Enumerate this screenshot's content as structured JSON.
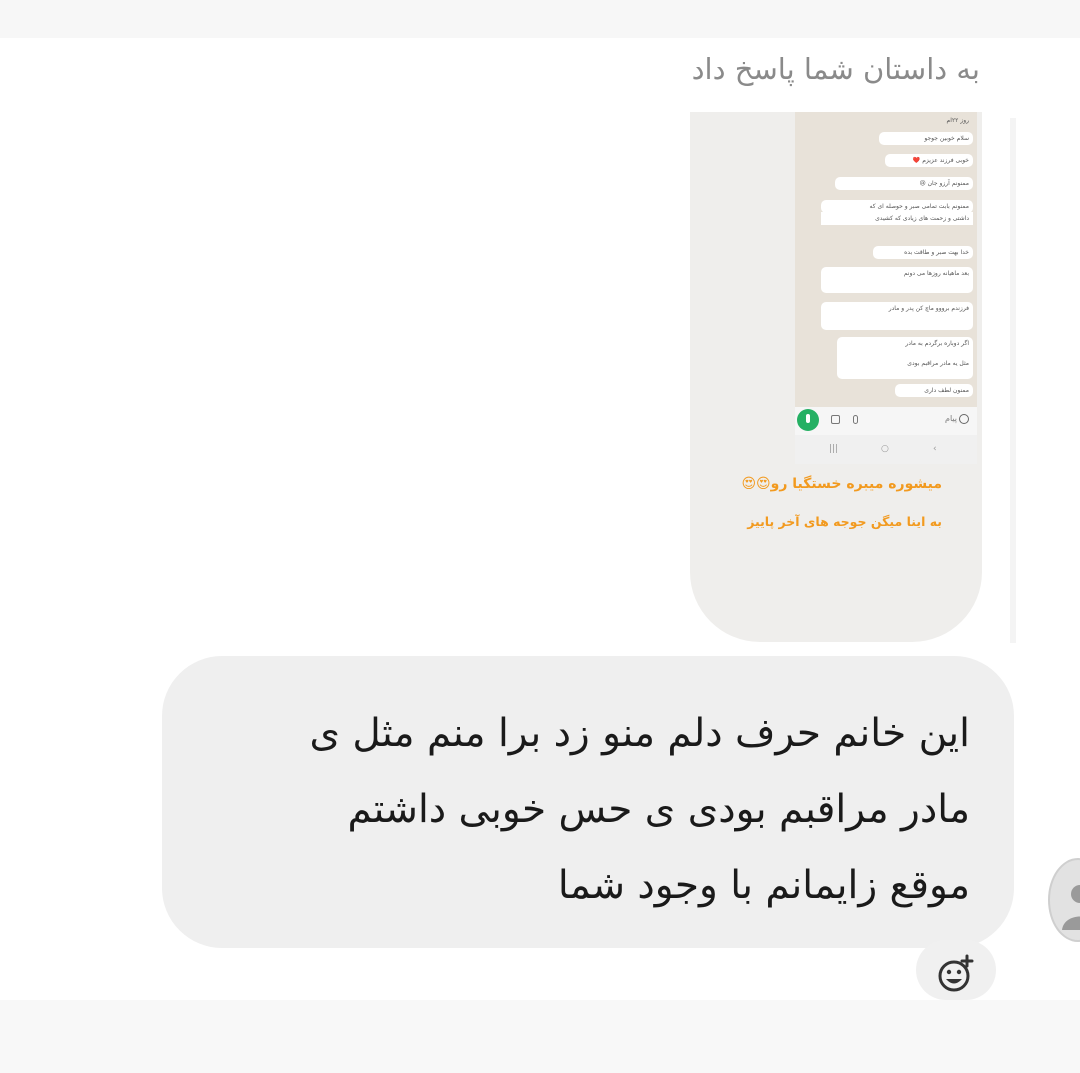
{
  "reply_header": "به داستان شما پاسخ داد",
  "story": {
    "screenshot_messages": [
      {
        "text": "روز ۲۲ام"
      },
      {
        "text": "سلام خوبین جوجو"
      },
      {
        "text": "خوبی فرزند عزیزم ❤️"
      },
      {
        "text": "ممنونم آرزو جان 😢"
      },
      {
        "text": "ممنونم بابت تمامی صبر و حوصله ای که"
      },
      {
        "text": "داشتی و زحمت های زیادی که کشیدی"
      },
      {
        "text": "خدا بهت صبر و طاقت بده"
      },
      {
        "text": "بعد ماهیانه روزها می دونم"
      },
      {
        "text": "فرزندم برووو ماچ کن پدر و مادر"
      },
      {
        "text": "اگر دوباره برگردم به مادر"
      },
      {
        "text": "مثل یه مادر مراقبم بودی"
      },
      {
        "text": "ممنون لطف داری"
      }
    ],
    "input_placeholder": "پیام",
    "caption_line1": "میشوره میبره خستگیا رو😍😍",
    "caption_line2": "به اینا میگن جوجه های آخر پاییز"
  },
  "message": {
    "text": "این خانم حرف دلم منو زد برا منم مثل ی\nمادر مراقبم بودی ی حس خوبی داشتم\nموقع زایمانم  با وجود شما"
  },
  "icons": {
    "reaction": "add-reaction-icon",
    "avatar": "user-avatar-icon",
    "mic": "microphone-icon"
  },
  "colors": {
    "caption": "#f29a1f",
    "bubble": "#efefef",
    "mic": "#25b063"
  }
}
